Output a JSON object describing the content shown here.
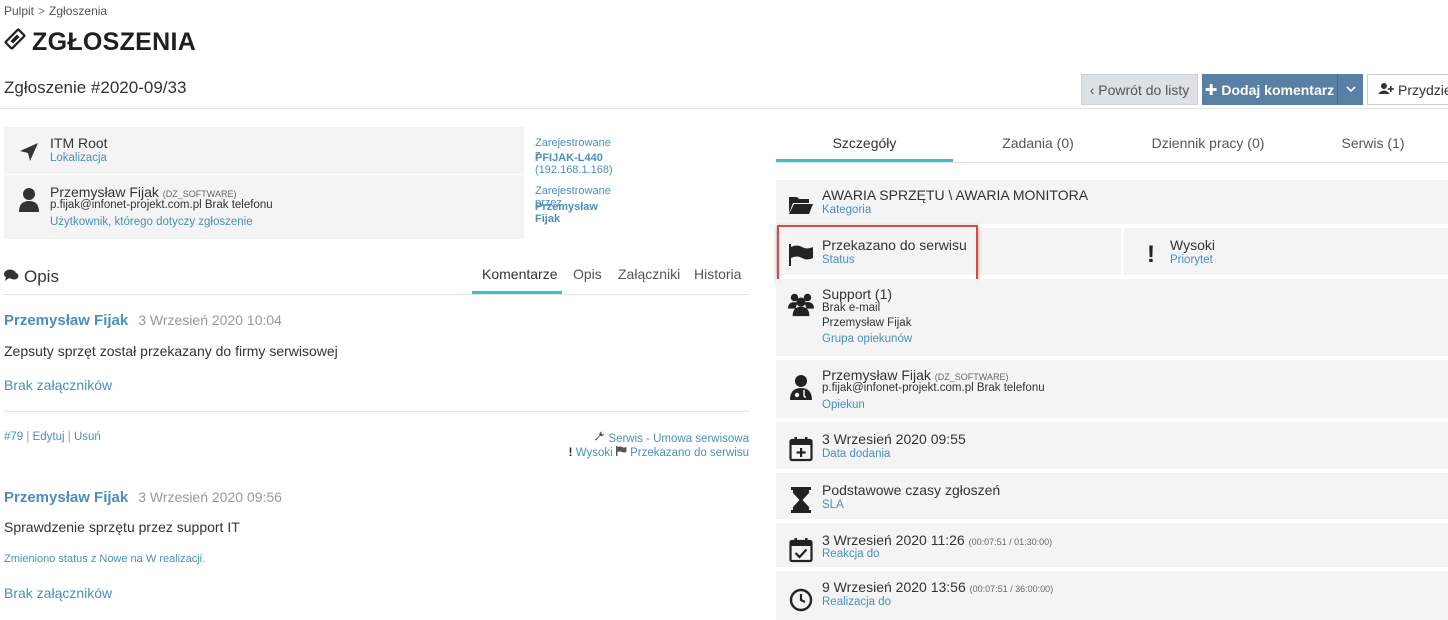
{
  "breadcrumb": {
    "home": "Pulpit",
    "sep": ">",
    "current": "Zgłoszenia"
  },
  "page_title": "ZGŁOSZENIA",
  "ticket_title": "Zgłoszenie #2020-09/33",
  "buttons": {
    "back": "‹ Powrót do listy",
    "add_comment": "Dodaj komentarz",
    "assign": "Przydziel"
  },
  "info": {
    "location_name": "ITM Root",
    "location_label": "Lokalizacja",
    "registered_from_label": "Zarejestrowane z",
    "registered_from_host": "PFIJAK-L440",
    "registered_from_ip": "(192.168.1.168)",
    "user_name": "Przemysław Fijak",
    "user_dept": "(DZ_SOFTWARE)",
    "user_email": "p.fijak@infonet-projekt.com.pl",
    "user_phone": "Brak telefonu",
    "user_label": "Użytkownik, którego dotyczy zgłoszenie",
    "registered_by_label": "Zarejestrowane przez",
    "registered_by_name": "Przemysław Fijak"
  },
  "opis": {
    "title": "Opis",
    "tabs": [
      "Komentarze",
      "Opis",
      "Załączniki",
      "Historia"
    ],
    "active_tab": "Komentarze"
  },
  "comments": [
    {
      "author": "Przemysław Fijak",
      "date": "3 Wrzesień 2020 10:04",
      "text": "Zepsuty sprzęt został przekazany do firmy serwisowej",
      "attachments": "Brak załączników",
      "id": "#79",
      "edit": "Edytuj",
      "delete": "Usuń",
      "service": "Serwis - Umowa serwisowa",
      "priority": "Wysoki",
      "status": "Przekazano do serwisu"
    },
    {
      "author": "Przemysław Fijak",
      "date": "3 Wrzesień 2020 09:56",
      "text": "Sprawdzenie sprzętu przez support IT",
      "change": "Zmieniono status z Nowe na W realizacji.",
      "attachments": "Brak załączników"
    }
  ],
  "right_tabs": [
    "Szczegóły",
    "Zadania (0)",
    "Dziennik pracy (0)",
    "Serwis (1)"
  ],
  "details": {
    "category_title": "AWARIA SPRZĘTU \\ AWARIA MONITORA",
    "category_label": "Kategoria",
    "status_title": "Przekazano do serwisu",
    "status_label": "Status",
    "priority_title": "Wysoki",
    "priority_label": "Priorytet",
    "group_title": "Support (1)",
    "group_email": "Brak e-mail",
    "group_member": "Przemysław Fijak",
    "group_label": "Grupa opiekunów",
    "caretaker_name": "Przemysław Fijak",
    "caretaker_dept": "(DZ_SOFTWARE)",
    "caretaker_email": "p.fijak@infonet-projekt.com.pl",
    "caretaker_phone": "Brak telefonu",
    "caretaker_label": "Opiekun",
    "added_date": "3 Wrzesień 2020 09:55",
    "added_label": "Data dodania",
    "sla_title": "Podstawowe czasy zgłoszeń",
    "sla_label": "SLA",
    "reaction_date": "3 Wrzesień 2020 11:26",
    "reaction_time": "(00:07:51 / 01:30:00)",
    "reaction_label": "Reakcja do",
    "realization_date": "9 Wrzesień 2020 13:56",
    "realization_time": "(00:07:51 / 36:00:00)",
    "realization_label": "Realizacja do"
  },
  "colors": {
    "accent": "#3bc0c3",
    "link": "#4a8fbe",
    "primary_button": "#5a7fa4",
    "highlight": "#e0473c"
  }
}
